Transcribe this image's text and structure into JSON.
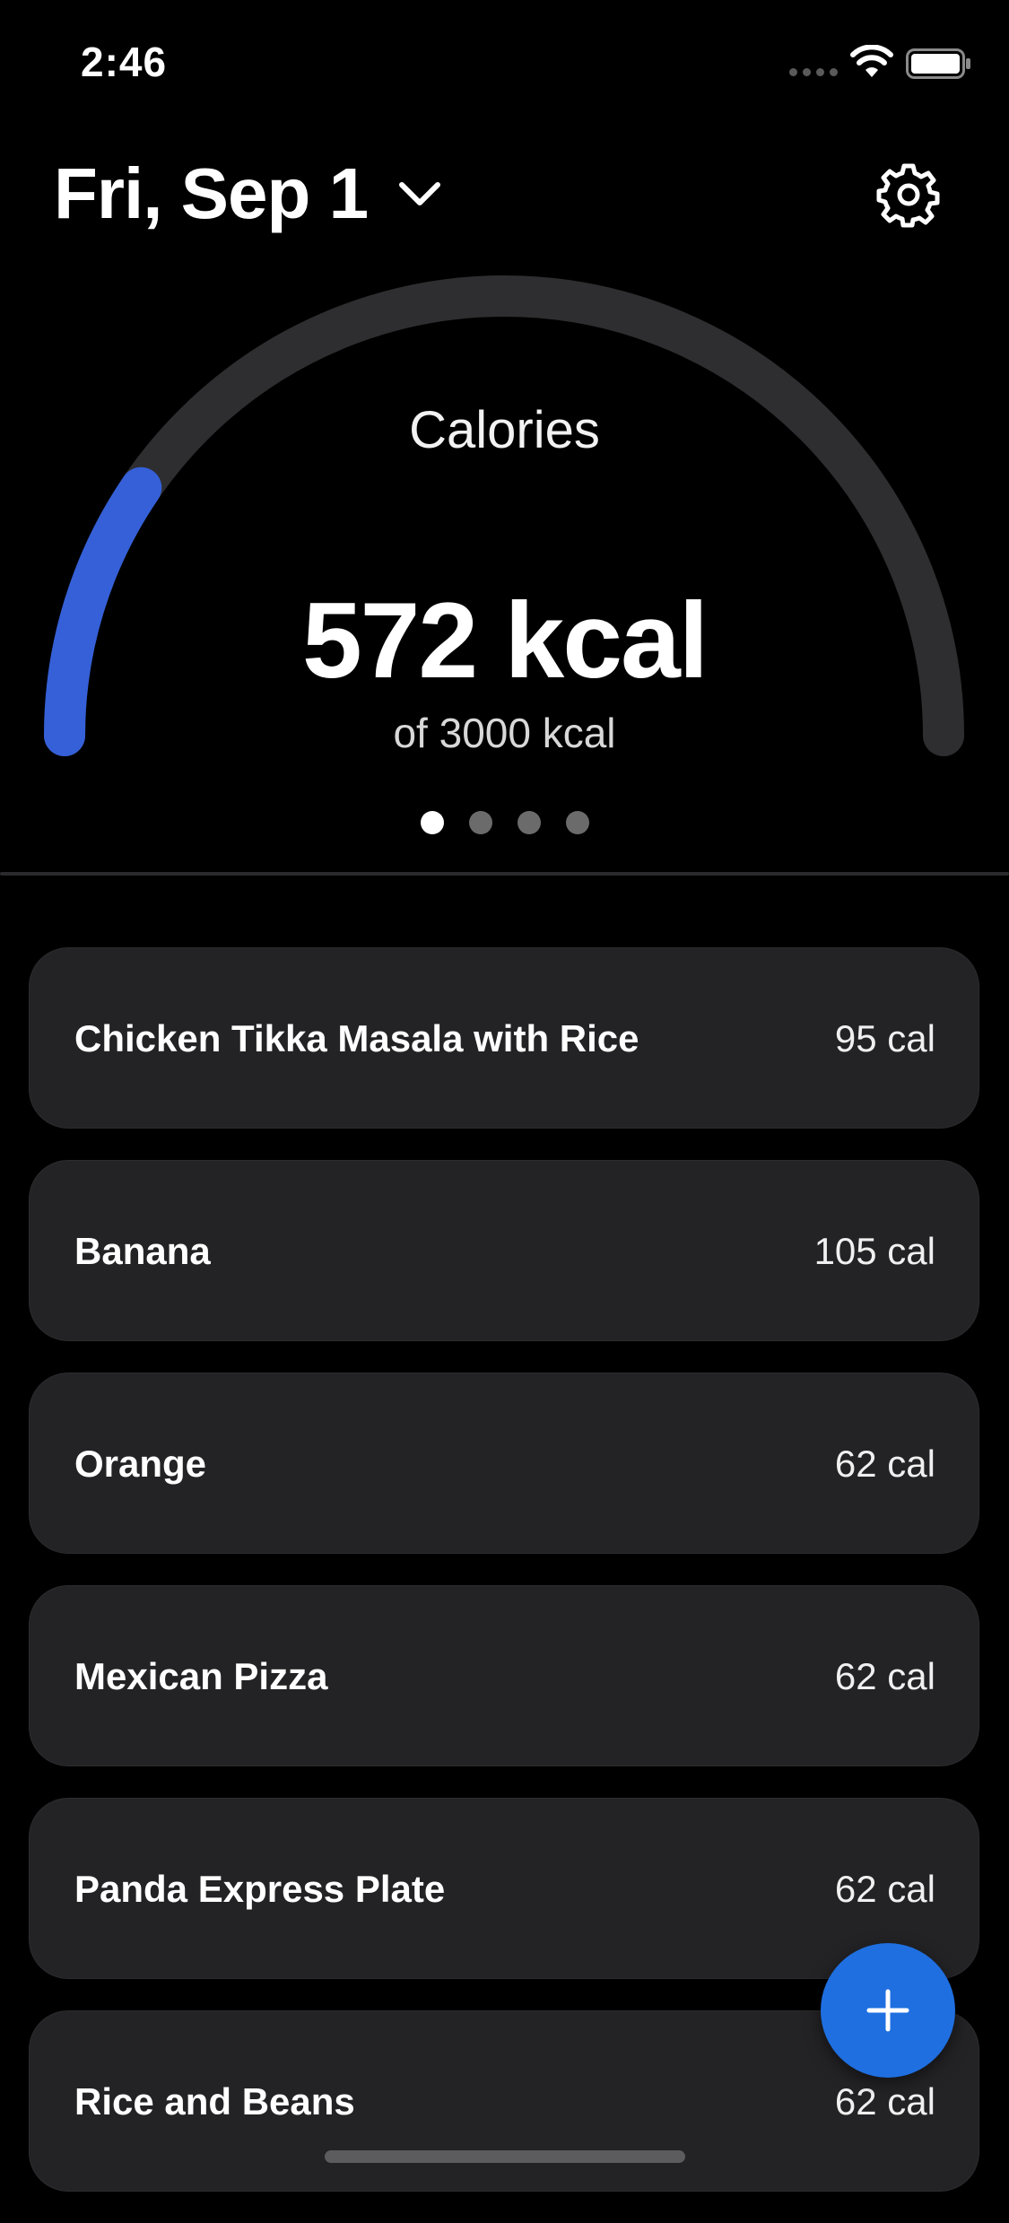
{
  "status_bar": {
    "time": "2:46",
    "signal_icon": "signal-dots-icon",
    "wifi_icon": "wifi-icon",
    "battery_icon": "battery-icon"
  },
  "header": {
    "date": "Fri, Sep 1",
    "date_dropdown_icon": "chevron-down-icon",
    "settings_icon": "gear-icon"
  },
  "gauge": {
    "label": "Calories",
    "value": "572 kcal",
    "goal": "of 3000 kcal",
    "consumed": 572,
    "target": 3000,
    "progress_color": "#3560d8",
    "track_color": "#2e2e30"
  },
  "pager": {
    "count": 4,
    "active_index": 0
  },
  "food_items": [
    {
      "name": "Chicken Tikka Masala with Rice",
      "calories": "95 cal"
    },
    {
      "name": "Banana",
      "calories": "105 cal"
    },
    {
      "name": "Orange",
      "calories": "62 cal"
    },
    {
      "name": "Mexican Pizza",
      "calories": "62 cal"
    },
    {
      "name": "Panda Express Plate",
      "calories": "62 cal"
    },
    {
      "name": "Rice and Beans",
      "calories": "62 cal"
    }
  ],
  "add_button": {
    "icon": "plus-icon",
    "color": "#1f6fe0"
  }
}
